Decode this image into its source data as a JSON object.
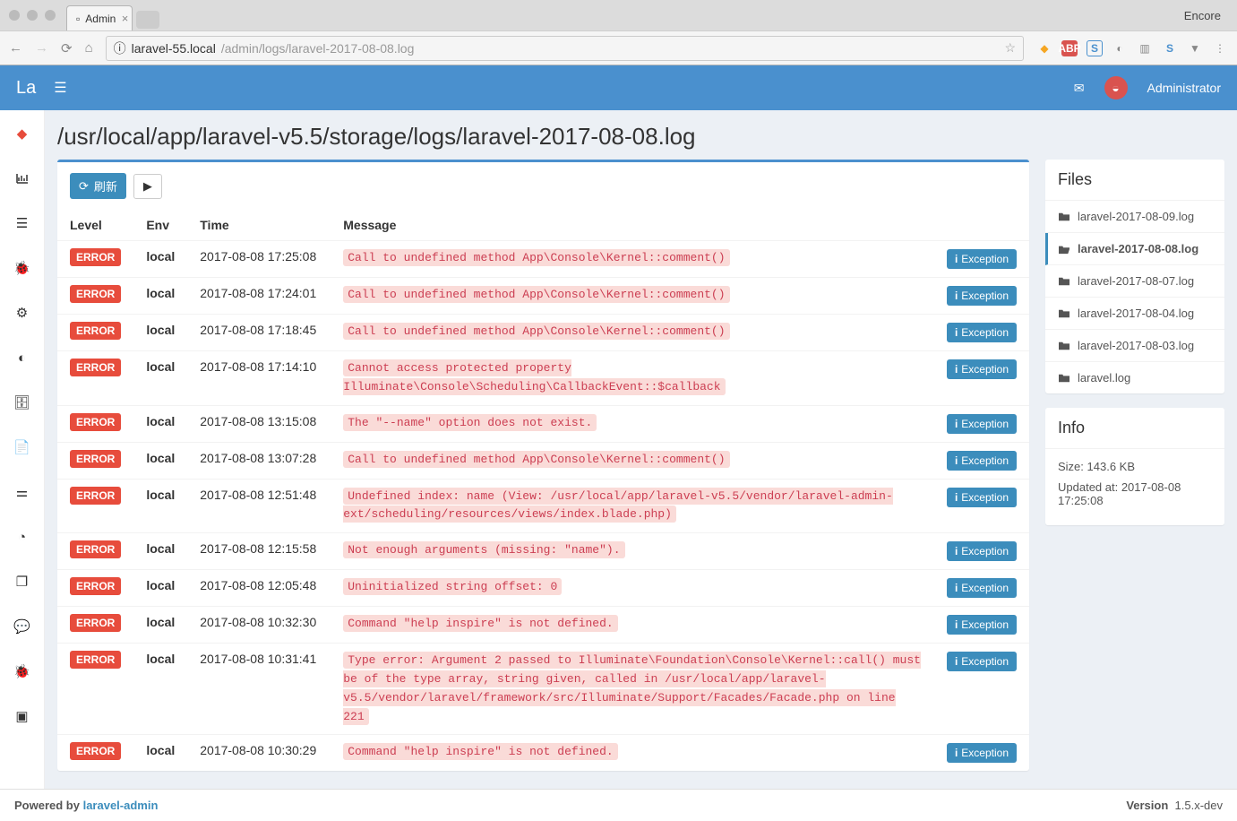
{
  "browser": {
    "tab_title": "Admin",
    "encore": "Encore",
    "url_host": "laravel-55.local",
    "url_path": "/admin/logs/laravel-2017-08-08.log"
  },
  "header": {
    "logo": "La",
    "username": "Administrator"
  },
  "page_title": "/usr/local/app/laravel-v5.5/storage/logs/laravel-2017-08-08.log",
  "toolbar": {
    "refresh_label": "刷新"
  },
  "table": {
    "headers": [
      "Level",
      "Env",
      "Time",
      "Message",
      ""
    ],
    "exception_label": "Exception",
    "rows": [
      {
        "level": "ERROR",
        "env": "local",
        "time": "2017-08-08 17:25:08",
        "message": "Call to undefined method App\\Console\\Kernel::comment()"
      },
      {
        "level": "ERROR",
        "env": "local",
        "time": "2017-08-08 17:24:01",
        "message": "Call to undefined method App\\Console\\Kernel::comment()"
      },
      {
        "level": "ERROR",
        "env": "local",
        "time": "2017-08-08 17:18:45",
        "message": "Call to undefined method App\\Console\\Kernel::comment()"
      },
      {
        "level": "ERROR",
        "env": "local",
        "time": "2017-08-08 17:14:10",
        "message": "Cannot access protected property Illuminate\\Console\\Scheduling\\CallbackEvent::$callback"
      },
      {
        "level": "ERROR",
        "env": "local",
        "time": "2017-08-08 13:15:08",
        "message": "The \"--name\" option does not exist."
      },
      {
        "level": "ERROR",
        "env": "local",
        "time": "2017-08-08 13:07:28",
        "message": "Call to undefined method App\\Console\\Kernel::comment()"
      },
      {
        "level": "ERROR",
        "env": "local",
        "time": "2017-08-08 12:51:48",
        "message": "Undefined index: name (View: /usr/local/app/laravel-v5.5/vendor/laravel-admin-ext/scheduling/resources/views/index.blade.php)"
      },
      {
        "level": "ERROR",
        "env": "local",
        "time": "2017-08-08 12:15:58",
        "message": "Not enough arguments (missing: \"name\")."
      },
      {
        "level": "ERROR",
        "env": "local",
        "time": "2017-08-08 12:05:48",
        "message": "Uninitialized string offset: 0"
      },
      {
        "level": "ERROR",
        "env": "local",
        "time": "2017-08-08 10:32:30",
        "message": "Command \"help inspire\" is not defined."
      },
      {
        "level": "ERROR",
        "env": "local",
        "time": "2017-08-08 10:31:41",
        "message": "Type error: Argument 2 passed to Illuminate\\Foundation\\Console\\Kernel::call() must be of the type array, string given, called in /usr/local/app/laravel-v5.5/vendor/laravel/framework/src/Illuminate/Support/Facades/Facade.php on line 221"
      },
      {
        "level": "ERROR",
        "env": "local",
        "time": "2017-08-08 10:30:29",
        "message": "Command \"help inspire\" is not defined."
      }
    ]
  },
  "files_panel": {
    "title": "Files",
    "files": [
      {
        "name": "laravel-2017-08-09.log",
        "active": false,
        "open": false
      },
      {
        "name": "laravel-2017-08-08.log",
        "active": true,
        "open": true
      },
      {
        "name": "laravel-2017-08-07.log",
        "active": false,
        "open": false
      },
      {
        "name": "laravel-2017-08-04.log",
        "active": false,
        "open": false
      },
      {
        "name": "laravel-2017-08-03.log",
        "active": false,
        "open": false
      },
      {
        "name": "laravel.log",
        "active": false,
        "open": false
      }
    ]
  },
  "info_panel": {
    "title": "Info",
    "size_label": "Size: 143.6 KB",
    "updated_label": "Updated at: 2017-08-08 17:25:08"
  },
  "footer": {
    "powered_prefix": "Powered by ",
    "powered_link": "laravel-admin",
    "version_label": "Version",
    "version_value": "1.5.x-dev"
  },
  "sidebar": {
    "icons": [
      "laravel",
      "chart",
      "server",
      "bug",
      "gears",
      "toggle",
      "database",
      "file",
      "sliders",
      "clock",
      "clone",
      "chat",
      "bug2",
      "wallet"
    ]
  }
}
